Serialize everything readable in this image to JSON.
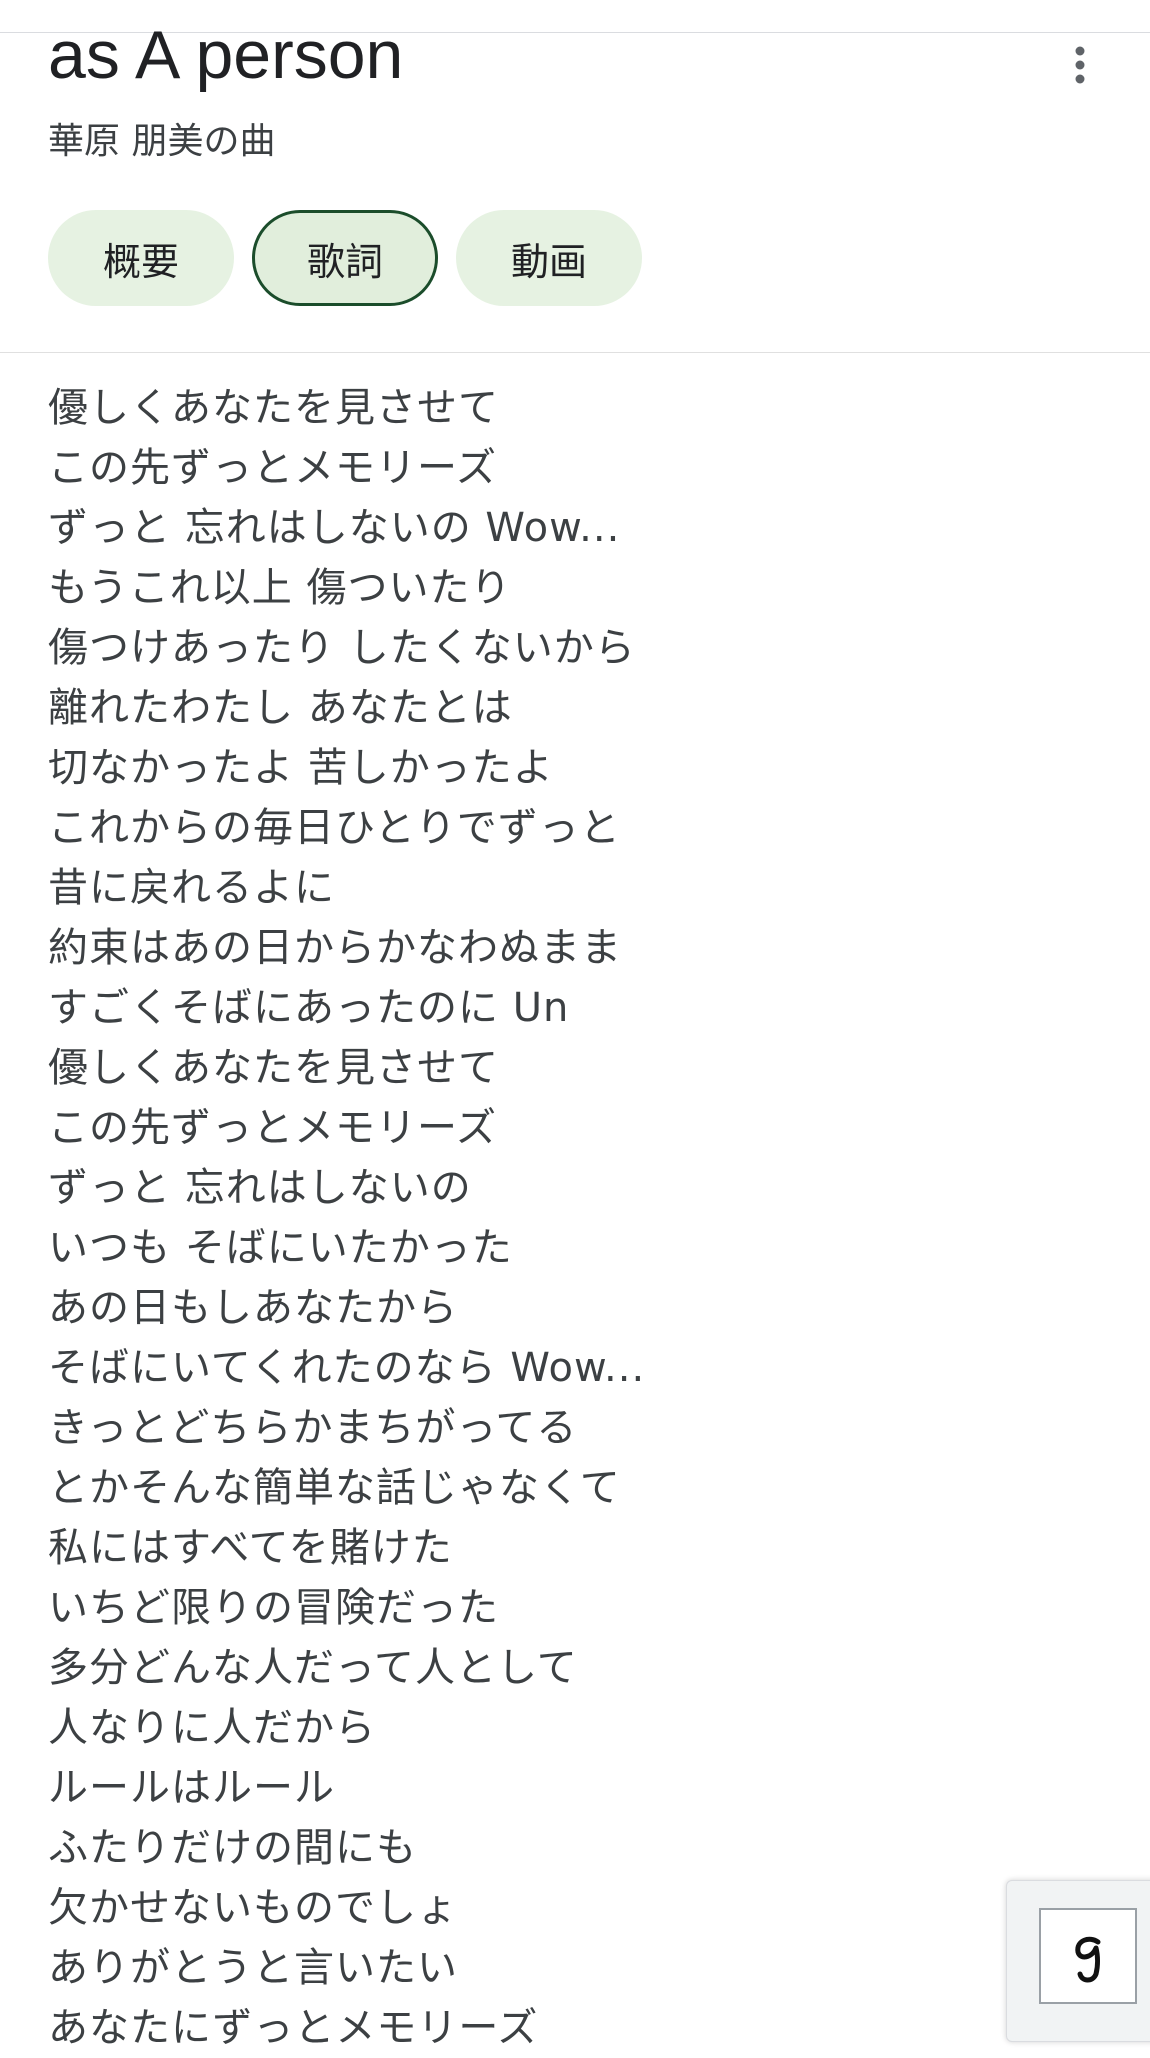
{
  "header": {
    "title": "as A person",
    "subtitle": "華原 朋美の曲",
    "more_icon": "more-vert-icon"
  },
  "tabs": [
    {
      "label": "概要",
      "active": false
    },
    {
      "label": "歌詞",
      "active": true
    },
    {
      "label": "動画",
      "active": false
    }
  ],
  "lyrics": [
    "優しくあなたを見させて",
    "この先ずっとメモリーズ",
    "ずっと 忘れはしないの Wow...",
    "もうこれ以上 傷ついたり",
    "傷つけあったり したくないから",
    "離れたわたし あなたとは",
    "切なかったよ 苦しかったよ",
    "これからの毎日ひとりでずっと",
    "昔に戻れるよに",
    "約束はあの日からかなわぬまま",
    "すごくそばにあったのに Un",
    "優しくあなたを見させて",
    "この先ずっとメモリーズ",
    "ずっと 忘れはしないの",
    "いつも そばにいたかった",
    "あの日もしあなたから",
    "そばにいてくれたのなら Wow...",
    "きっとどちらかまちがってる",
    "とかそんな簡単な話じゃなくて",
    "私にはすべてを賭けた",
    "いちど限りの冒険だった",
    "多分どんな人だって人として",
    "人なりに人だから",
    "ルールはルール",
    "ふたりだけの間にも",
    "欠かせないものでしょ",
    "ありがとうと言いたい",
    "あなたにずっとメモリーズ"
  ],
  "corner_button": {
    "icon": "handwriting-g-icon",
    "glyph": "g"
  },
  "colors": {
    "chip_bg": "#e6f2e2",
    "chip_active_border": "#1b4d2b",
    "text_primary": "#202124",
    "text_secondary": "#3c4043"
  }
}
